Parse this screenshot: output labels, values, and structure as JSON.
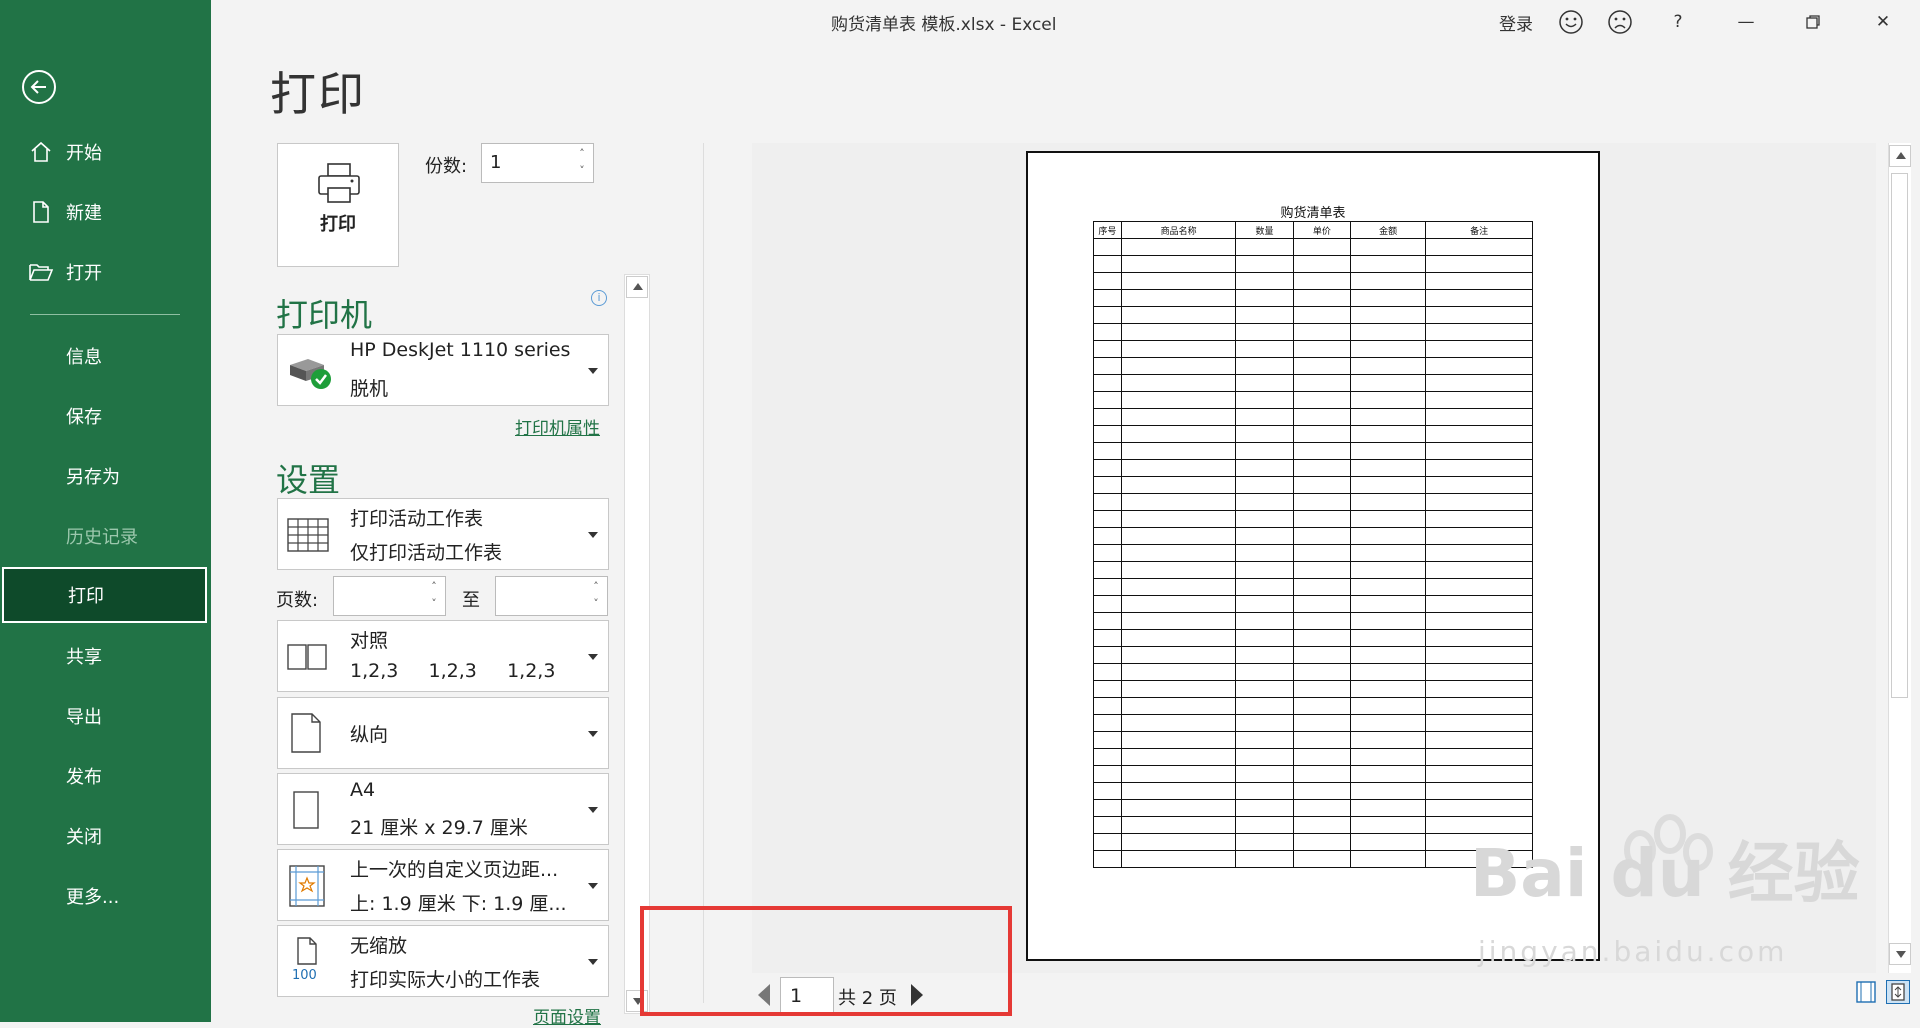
{
  "window": {
    "title": "购货清单表 模板.xlsx  -  Excel",
    "signin": "登录",
    "help": "?",
    "minimize": "—",
    "close": "✕"
  },
  "sidebar": {
    "items": [
      {
        "label": "开始"
      },
      {
        "label": "新建"
      },
      {
        "label": "打开"
      },
      {
        "label": "信息"
      },
      {
        "label": "保存"
      },
      {
        "label": "另存为"
      },
      {
        "label": "历史记录"
      },
      {
        "label": "打印"
      },
      {
        "label": "共享"
      },
      {
        "label": "导出"
      },
      {
        "label": "发布"
      },
      {
        "label": "关闭"
      },
      {
        "label": "更多..."
      }
    ]
  },
  "print": {
    "heading": "打印",
    "button_label": "打印",
    "copies_label": "份数:",
    "copies_value": "1"
  },
  "printer": {
    "section": "打印机",
    "name": "HP DeskJet 1110 series",
    "status": "脱机",
    "properties_link": "打印机属性"
  },
  "settings": {
    "section": "设置",
    "scope_line1": "打印活动工作表",
    "scope_line2": "仅打印活动工作表",
    "pages_label": "页数:",
    "pages_to": "至",
    "collate_line1": "对照",
    "collate_line2": "1,2,3     1,2,3     1,2,3",
    "orientation": "纵向",
    "paper_line1": "A4",
    "paper_line2": "21 厘米 x 29.7 厘米",
    "margins_line1": "上一次的自定义页边距...",
    "margins_line2": "上: 1.9 厘米 下: 1.9 厘...",
    "scale_line1": "无缩放",
    "scale_line2": "打印实际大小的工作表",
    "scale_icon_text": "100",
    "page_setup_link": "页面设置"
  },
  "preview": {
    "sheet_title": "购货清单表",
    "columns": [
      "序号",
      "商品名称",
      "数量",
      "单价",
      "金额",
      "备注"
    ],
    "current_page": "1",
    "total_pages": "共 2 页"
  },
  "watermark": {
    "brand": "Bai  du 经验",
    "url": "jingyan.baidu.com"
  },
  "colors": {
    "sidebar": "#217346",
    "active": "#0e4a2a",
    "highlight": "#e53935"
  }
}
